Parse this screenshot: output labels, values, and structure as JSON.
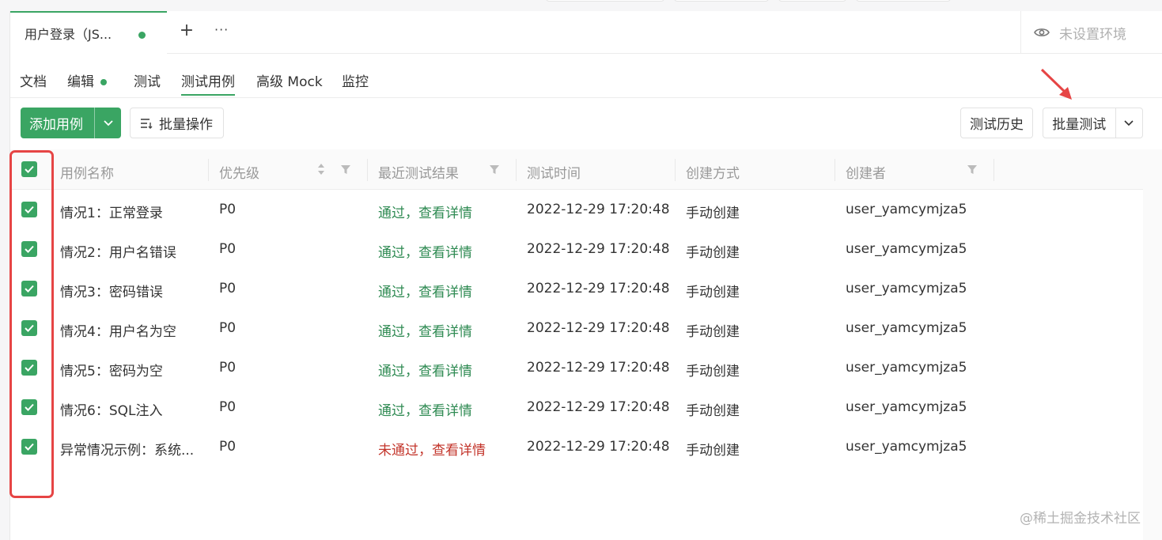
{
  "tabbar": {
    "active_tab_title": "用户登录（JS...",
    "add_symbol": "+",
    "more_symbol": "···",
    "environment": "未设置环境"
  },
  "subtabs": [
    "文档",
    "编辑",
    "测试",
    "测试用例",
    "高级 Mock",
    "监控"
  ],
  "toolbar": {
    "add_case": "添加用例",
    "batch_operation": "批量操作",
    "test_history": "测试历史",
    "batch_test": "批量测试"
  },
  "table": {
    "columns": [
      "用例名称",
      "优先级",
      "最近测试结果",
      "测试时间",
      "创建方式",
      "创建者"
    ],
    "rows": [
      {
        "name": "情况1：正常登录",
        "priority": "P0",
        "result": "通过，查看详情",
        "result_status": "pass",
        "time": "2022-12-29 17:20:48",
        "method": "手动创建",
        "creator": "user_yamcymjza5"
      },
      {
        "name": "情况2：用户名错误",
        "priority": "P0",
        "result": "通过，查看详情",
        "result_status": "pass",
        "time": "2022-12-29 17:20:48",
        "method": "手动创建",
        "creator": "user_yamcymjza5"
      },
      {
        "name": "情况3：密码错误",
        "priority": "P0",
        "result": "通过，查看详情",
        "result_status": "pass",
        "time": "2022-12-29 17:20:48",
        "method": "手动创建",
        "creator": "user_yamcymjza5"
      },
      {
        "name": "情况4：用户名为空",
        "priority": "P0",
        "result": "通过，查看详情",
        "result_status": "pass",
        "time": "2022-12-29 17:20:48",
        "method": "手动创建",
        "creator": "user_yamcymjza5"
      },
      {
        "name": "情况5：密码为空",
        "priority": "P0",
        "result": "通过，查看详情",
        "result_status": "pass",
        "time": "2022-12-29 17:20:48",
        "method": "手动创建",
        "creator": "user_yamcymjza5"
      },
      {
        "name": "情况6：SQL注入",
        "priority": "P0",
        "result": "通过，查看详情",
        "result_status": "pass",
        "time": "2022-12-29 17:20:48",
        "method": "手动创建",
        "creator": "user_yamcymjza5"
      },
      {
        "name": "异常情况示例：系统...",
        "priority": "P0",
        "result": "未通过，查看详情",
        "result_status": "fail",
        "time": "2022-12-29 17:20:48",
        "method": "手动创建",
        "creator": "user_yamcymjza5"
      }
    ]
  },
  "watermark": "@稀土掘金技术社区",
  "colors": {
    "accent": "#3aa563",
    "pass": "#2e8a52",
    "fail": "#c3352b",
    "annotation": "#e64545"
  }
}
